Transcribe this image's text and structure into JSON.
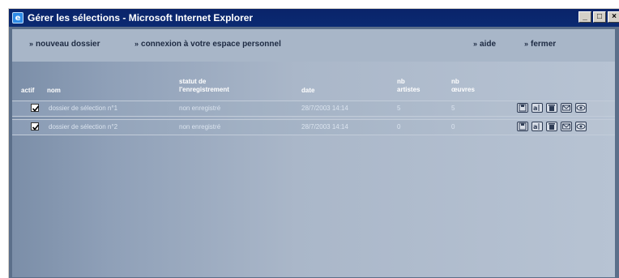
{
  "window": {
    "title": "Gérer les sélections - Microsoft Internet Explorer",
    "controls": [
      "_",
      "□",
      "×"
    ]
  },
  "nav": {
    "new_folder": "nouveau dossier",
    "login": "connexion à votre espace personnel",
    "help": "aide",
    "close": "fermer",
    "arrow": "»"
  },
  "table": {
    "headers": {
      "actif": "actif",
      "nom": "nom",
      "statut_line1": "statut de",
      "statut_line2": "l'enregistrement",
      "date": "date",
      "artistes_line1": "nb",
      "artistes_line2": "artistes",
      "oeuvres_line1": "nb",
      "oeuvres_line2": "œuvres"
    },
    "rows": [
      {
        "checked": true,
        "nom": "dossier de sélection n°1",
        "statut": "non enregistré",
        "date": "28/7/2003 14:14",
        "artistes": "5",
        "oeuvres": "5"
      },
      {
        "checked": true,
        "nom": "dossier de sélection n°2",
        "statut": "non enregistré",
        "date": "28/7/2003 14:14",
        "artistes": "0",
        "oeuvres": "0"
      }
    ],
    "row_actions": [
      "save-icon",
      "rename-icon",
      "delete-icon",
      "email-icon",
      "view-icon"
    ]
  },
  "colors": {
    "titlebar": "#0a246a",
    "content_bg": "#a8b6c8",
    "header_text": "#ffffff",
    "row_text": "#dbe4ef"
  }
}
